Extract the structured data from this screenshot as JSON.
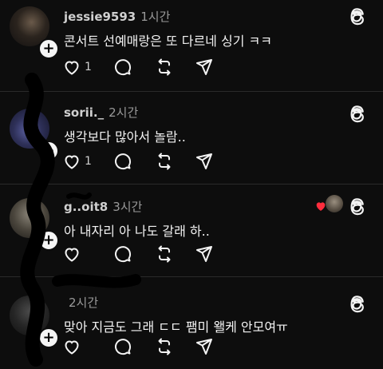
{
  "posts": [
    {
      "user": "jessie9593",
      "time": "1시간",
      "text": "콘서트 선예매랑은 또 다르네 싱기 ㅋㅋ",
      "likes": "1",
      "liked_by_author": false
    },
    {
      "user": "sorii._",
      "time": "2시간",
      "text": "생각보다 많아서 놀람..",
      "likes": "1",
      "liked_by_author": false
    },
    {
      "user": "g..oit8",
      "time": "3시간",
      "text": "아 내자리 아 나도 갈래 하..",
      "likes": "",
      "liked_by_author": true
    },
    {
      "user": "",
      "time": "2시간",
      "text": "맞아 지금도 그래 ㄷㄷ 팸미 왤케 안모여ㅠ",
      "likes": "",
      "liked_by_author": false
    }
  ],
  "icons": {
    "like": "heart-icon",
    "comment": "comment-icon",
    "repost": "repost-icon",
    "share": "share-icon",
    "threads": "threads-logo-icon",
    "follow": "plus-icon"
  },
  "colors": {
    "background": "#0d0d0d",
    "text": "#f3f3f3",
    "muted": "#9a9a9a",
    "heart_red": "#ff2d3d"
  }
}
